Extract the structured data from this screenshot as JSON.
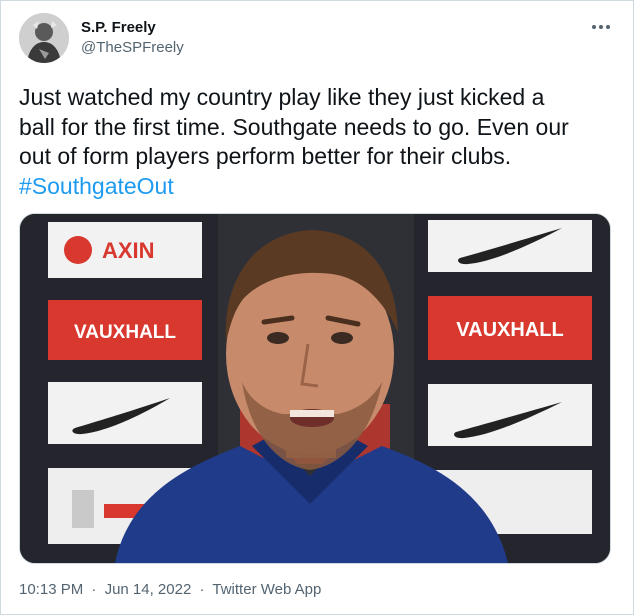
{
  "author": {
    "name": "S.P. Freely",
    "handle": "@TheSPFreely"
  },
  "tweet": {
    "lines": [
      "Just watched my country play like they just kicked a",
      "ball for the first time.  Southgate needs to go.  Even our",
      "out of form players perform better for their clubs."
    ],
    "hashtag": "#SouthgateOut"
  },
  "media": {
    "backdrop_logos": [
      "VAUXHALL",
      "VAUXHALL",
      "AXIN"
    ]
  },
  "footer": {
    "time": "10:13 PM",
    "date": "Jun 14, 2022",
    "source": "Twitter Web App",
    "separator": "·"
  },
  "colors": {
    "text": "#0f1419",
    "secondary": "#536471",
    "link": "#1d9bf0",
    "sponsor_red": "#d8382e",
    "shirt_blue": "#1f3b8a"
  },
  "icons": {
    "more": "more-horizontal-icon",
    "nike": "nike-swoosh-logo"
  }
}
